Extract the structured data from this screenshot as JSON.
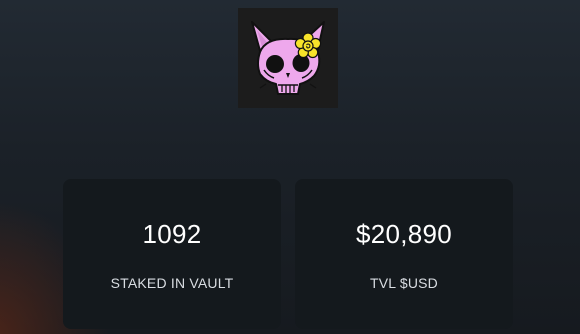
{
  "logo": {
    "icon": "pink-cat-skull-with-yellow-flower-icon",
    "colors": {
      "background": "#1c1c1c",
      "skull": "#eea8ec",
      "outline": "#111111",
      "flower": "#f7e32a"
    }
  },
  "stats": [
    {
      "value": "1092",
      "label": "STAKED IN VAULT"
    },
    {
      "value": "$20,890",
      "label": "TVL $USD"
    }
  ]
}
